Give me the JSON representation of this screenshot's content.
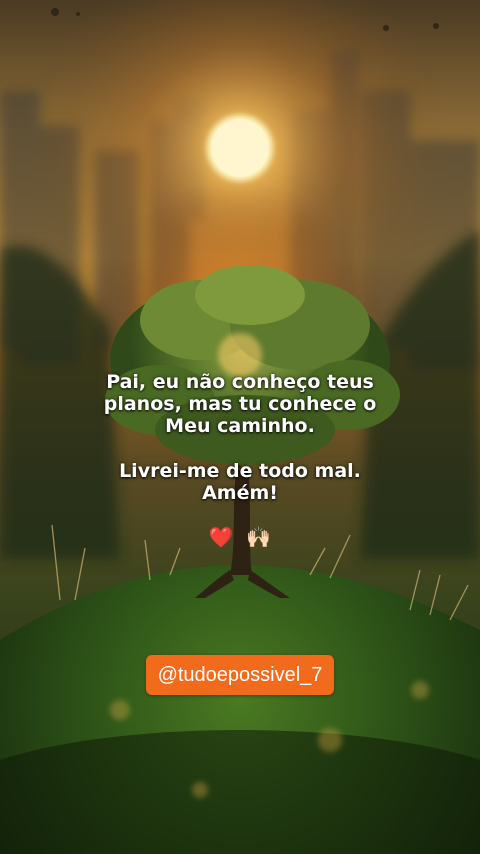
{
  "caption": {
    "paragraph1": [
      "Pai, eu não conheço teus",
      "planos, mas tu conhece o",
      "Meu caminho."
    ],
    "paragraph2": [
      "Livrei-me de todo mal.",
      "Amém!"
    ]
  },
  "emoji": {
    "icons": [
      "heart-icon",
      "raised-hands-icon"
    ],
    "heart": "❤️",
    "hands": "🙌🏻"
  },
  "handle": "@tudoepossivel_7",
  "colors": {
    "badge": "#f26a1c",
    "text": "#ffffff",
    "sun": "#fff2b8"
  }
}
